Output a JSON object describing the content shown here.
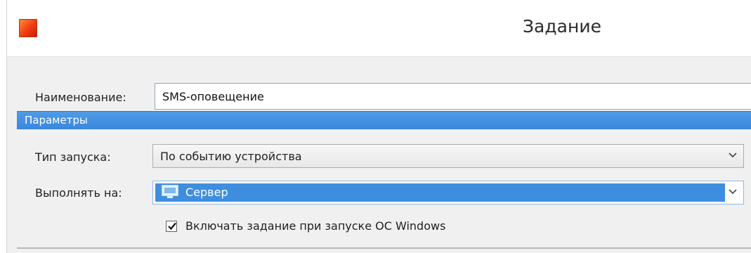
{
  "window": {
    "title": "Задание",
    "icon": "app-icon",
    "icon_color": "#f0421a"
  },
  "name": {
    "label": "Наименование:",
    "value": "SMS-оповещение"
  },
  "section": {
    "title": "Параметры",
    "color": "#3a86dc"
  },
  "launch_type": {
    "label": "Тип запуска:",
    "selected": "По событию устройства",
    "icon": "chevron-down-icon"
  },
  "run_on": {
    "label": "Выполнять на:",
    "selected": "Сервер",
    "item_icon": "monitor-icon",
    "icon": "chevron-down-icon"
  },
  "run_on_windows_start": {
    "label": "Включать задание при запуске ОС Windows",
    "checked": true
  }
}
